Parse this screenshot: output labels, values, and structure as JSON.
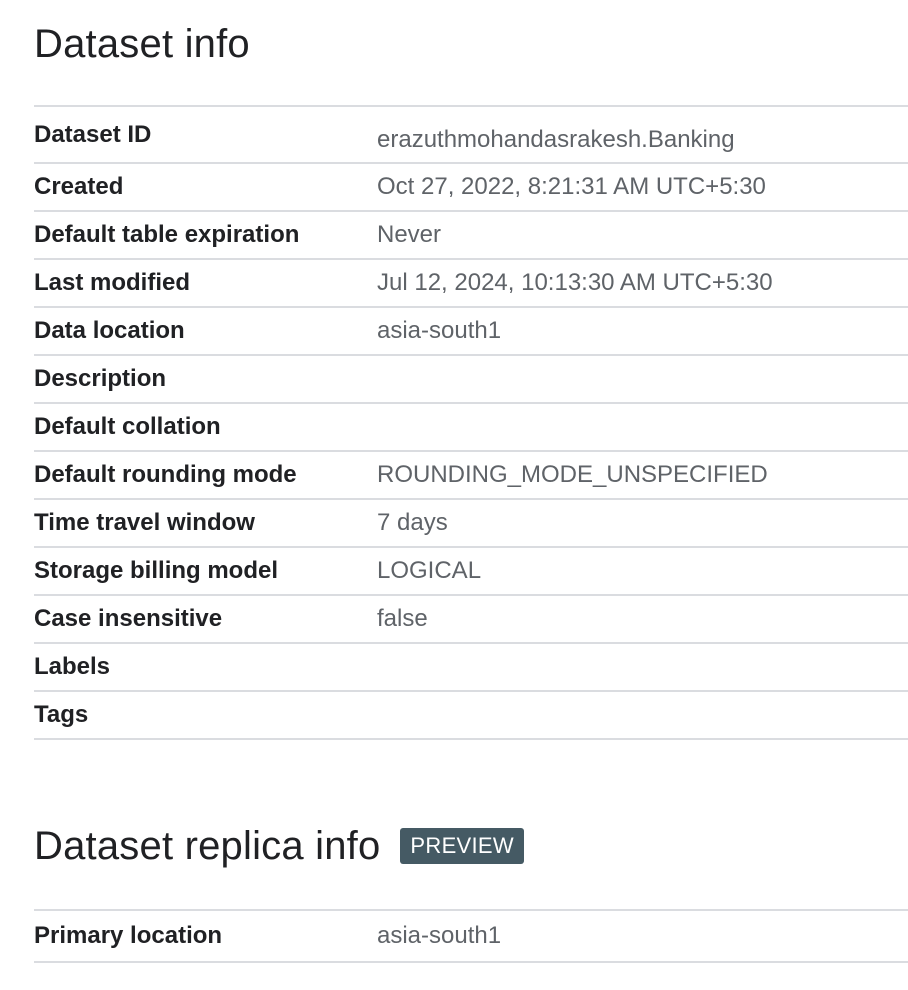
{
  "dataset_info": {
    "title": "Dataset info",
    "rows": [
      {
        "label": "Dataset ID",
        "value": "erazuthmohandasrakesh.Banking"
      },
      {
        "label": "Created",
        "value": "Oct 27, 2022, 8:21:31 AM UTC+5:30"
      },
      {
        "label": "Default table expiration",
        "value": "Never"
      },
      {
        "label": "Last modified",
        "value": "Jul 12, 2024, 10:13:30 AM UTC+5:30"
      },
      {
        "label": "Data location",
        "value": "asia-south1"
      },
      {
        "label": "Description",
        "value": ""
      },
      {
        "label": "Default collation",
        "value": ""
      },
      {
        "label": "Default rounding mode",
        "value": "ROUNDING_MODE_UNSPECIFIED"
      },
      {
        "label": "Time travel window",
        "value": "7 days"
      },
      {
        "label": "Storage billing model",
        "value": "LOGICAL"
      },
      {
        "label": "Case insensitive",
        "value": "false"
      },
      {
        "label": "Labels",
        "value": ""
      },
      {
        "label": "Tags",
        "value": ""
      }
    ]
  },
  "replica_info": {
    "title": "Dataset replica info",
    "badge": "PREVIEW",
    "rows": [
      {
        "label": "Primary location",
        "value": "asia-south1"
      }
    ]
  },
  "colors": {
    "divider": "#dadce0",
    "label_text": "#202124",
    "value_text": "#5f6368",
    "badge_bg": "#455a64",
    "badge_text": "#ffffff"
  }
}
